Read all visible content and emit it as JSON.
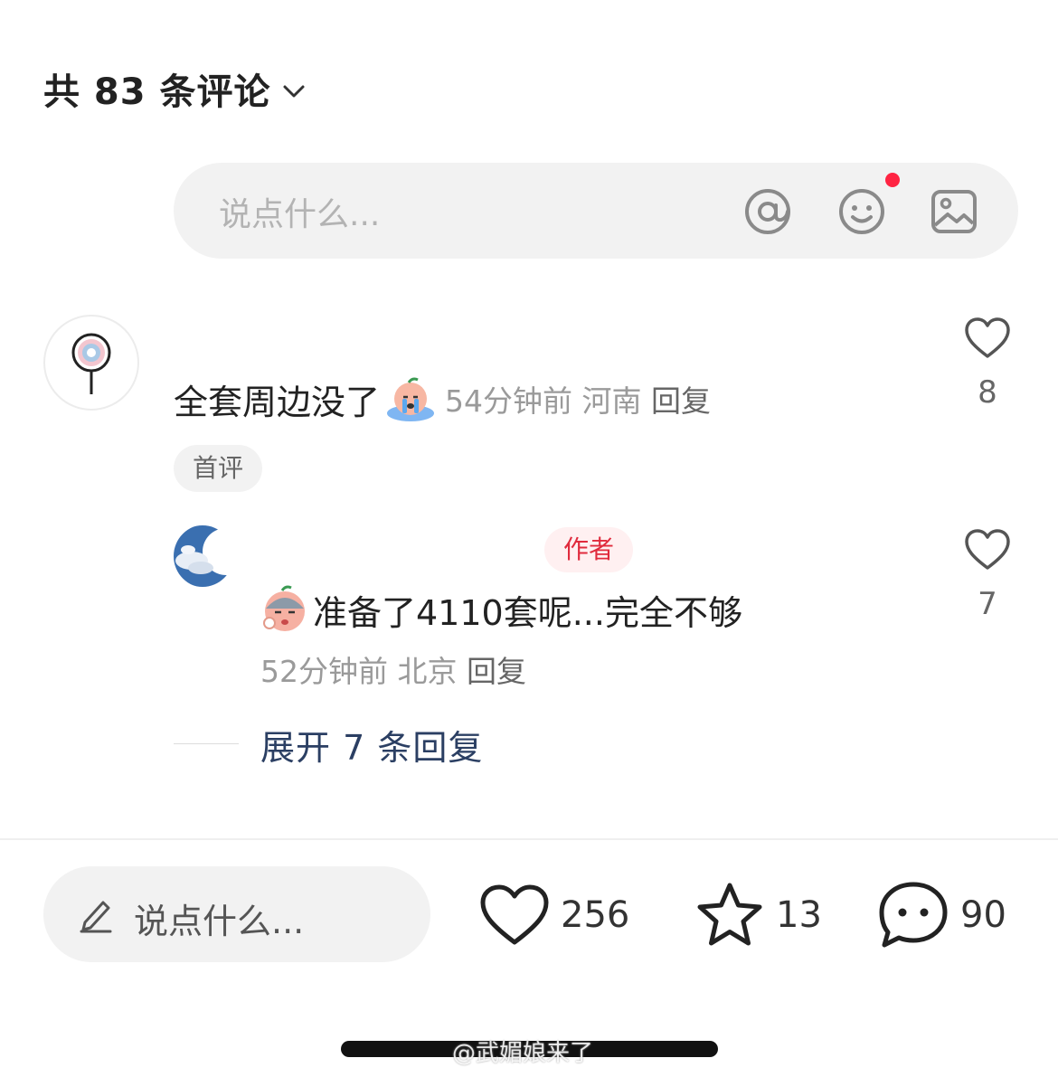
{
  "header": {
    "title": "共 83 条评论"
  },
  "top_input": {
    "placeholder": "说点什么..."
  },
  "comments": [
    {
      "text": "全套周边没了",
      "time": "54分钟前",
      "location": "河南",
      "reply_label": "回复",
      "badge": "首评",
      "likes": "8"
    },
    {
      "author_badge": "作者",
      "text": "准备了4110套呢...完全不够",
      "time": "52分钟前",
      "location": "北京",
      "reply_label": "回复",
      "likes": "7"
    }
  ],
  "expand_replies": "展开 7 条回复",
  "bottom_bar": {
    "placeholder": "说点什么...",
    "likes": "256",
    "stars": "13",
    "comments": "90"
  },
  "watermark": "@武媚娘来了",
  "colors": {
    "accent_red": "#ff2442",
    "author_red": "#e02b3d",
    "link_blue": "#2b3f63"
  }
}
